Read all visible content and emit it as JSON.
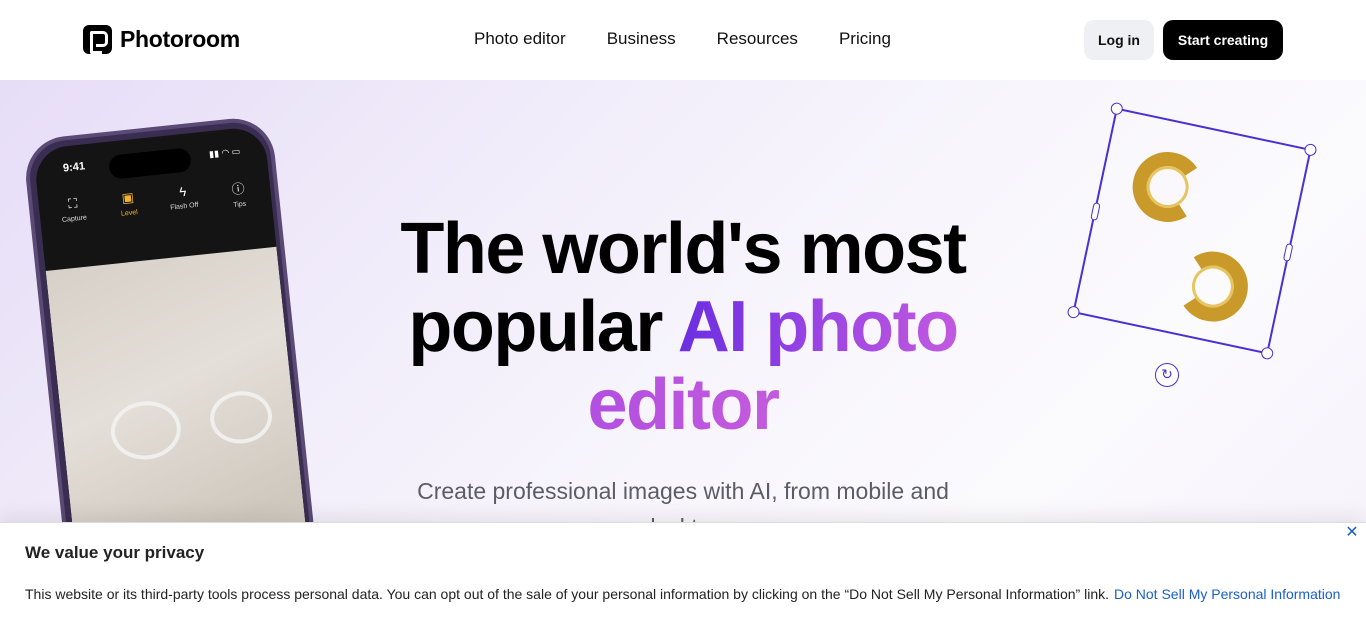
{
  "header": {
    "logo_text": "Photoroom",
    "nav": [
      "Photo editor",
      "Business",
      "Resources",
      "Pricing"
    ],
    "login_label": "Log in",
    "start_label": "Start creating"
  },
  "hero": {
    "headline_line1": "The world's most",
    "headline_line2_plain": "popular ",
    "headline_line2_accent": "AI photo",
    "headline_line3_accent": "editor",
    "subtitle": "Create professional images with AI, from mobile and desktop"
  },
  "phone": {
    "time": "9:41",
    "tools": [
      {
        "label": "Capture",
        "icon": "capture-icon"
      },
      {
        "label": "Level",
        "icon": "level-icon"
      },
      {
        "label": "Flash Off",
        "icon": "flash-off-icon"
      },
      {
        "label": "Tips",
        "icon": "tips-icon"
      }
    ]
  },
  "privacy": {
    "title": "We value your privacy",
    "text": "This website or its third-party tools process personal data. You can opt out of the sale of your personal information by clicking on the “Do Not Sell My Personal Information” link.",
    "link": "Do Not Sell My Personal Information",
    "close_symbol": "✕"
  },
  "colors": {
    "accent": "#6b2ee0",
    "accent_pink": "#c25adf",
    "selection": "#4a2fd1",
    "link": "#1a5fc9"
  }
}
